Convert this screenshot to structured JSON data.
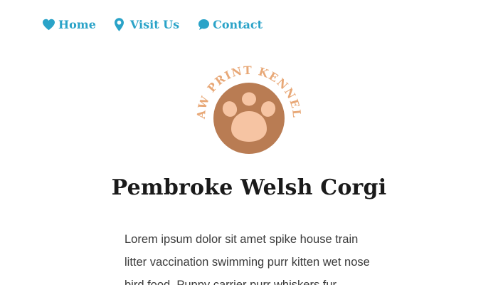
{
  "nav": {
    "items": [
      {
        "label": "Home",
        "icon": "heart-icon"
      },
      {
        "label": "Visit Us",
        "icon": "map-pin-icon"
      },
      {
        "label": "Contact",
        "icon": "speech-bubble-icon"
      }
    ]
  },
  "logo": {
    "text": "PAW PRINT KENNELS",
    "colors": {
      "ring_text": "#e8a877",
      "circle": "#b97c53",
      "pads": "#f6c4a3"
    }
  },
  "page": {
    "title": "Pembroke Welsh Corgi",
    "body": "Lorem ipsum dolor sit amet spike house train litter vaccination swimming purr kitten wet nose bird food. Puppy carrier purr whiskers fur"
  },
  "colors": {
    "accent": "#2aa3c8",
    "title": "#1a1a1a",
    "body": "#3a3a3a"
  }
}
